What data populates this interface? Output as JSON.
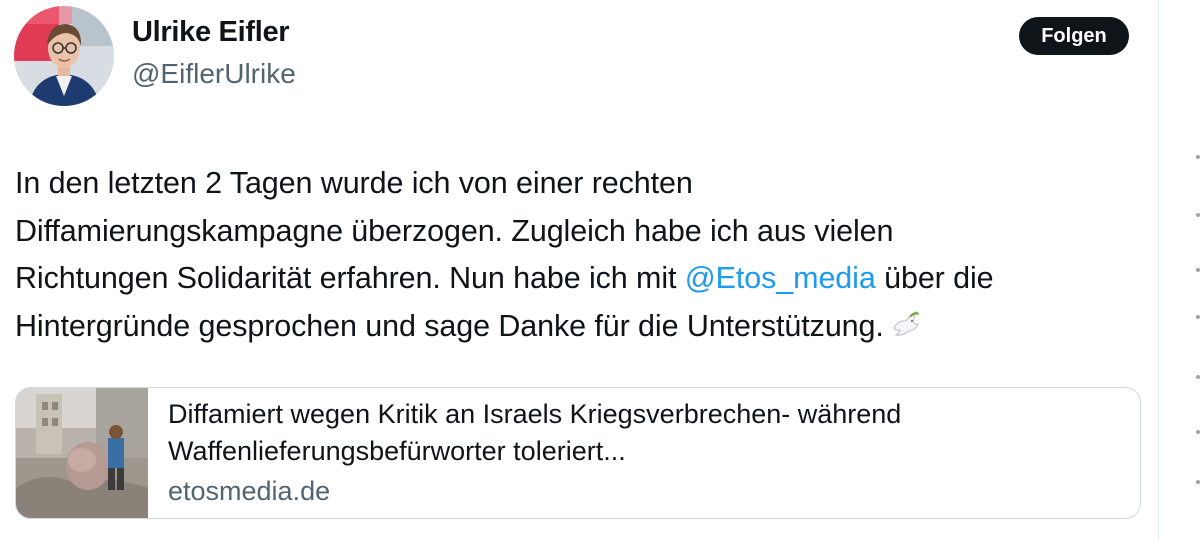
{
  "author": {
    "name": "Ulrike Eifler",
    "handle": "@EiflerUlrike"
  },
  "follow_label": "Folgen",
  "tweet": {
    "lines": [
      "In den letzten 2 Tagen wurde ich von einer rechten",
      "Diffamierungskampagne überzogen. Zugleich habe ich aus vielen"
    ],
    "line3_before": "Richtungen Solidarität erfahren. Nun habe ich mit ",
    "mention": "@Etos_media",
    "line3_after": " über die",
    "line4": "Hintergründe gesprochen und sage Danke für die Unterstützung.",
    "emoji_icon": "dove-of-peace-icon"
  },
  "link_card": {
    "title_line1": "Diffamiert wegen Kritik an Israels Kriegsverbrechen- während",
    "title_line2": "Waffenlieferungsbefürworter toleriert...",
    "domain": "etosmedia.de"
  },
  "colors": {
    "mention": "#1d9bf0",
    "follow_bg": "#0f1419",
    "secondary_text": "#536471",
    "card_border": "#cfd9de"
  }
}
